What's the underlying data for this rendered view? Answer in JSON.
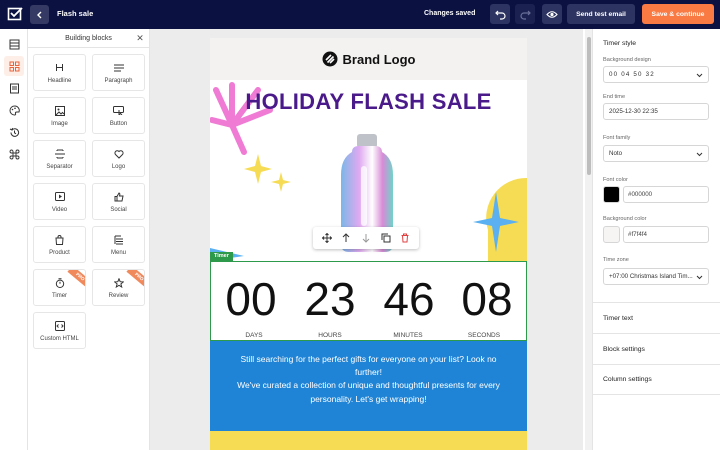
{
  "app": {
    "title": "Flash sale",
    "status": "Changes saved",
    "test_button": "Send test email",
    "save_button": "Save & continue"
  },
  "blocks_panel": {
    "title": "Building blocks",
    "items": [
      {
        "label": "Headline",
        "icon": "heading-icon",
        "pro": false
      },
      {
        "label": "Paragraph",
        "icon": "paragraph-icon",
        "pro": false
      },
      {
        "label": "Image",
        "icon": "image-icon",
        "pro": false
      },
      {
        "label": "Button",
        "icon": "button-icon",
        "pro": false
      },
      {
        "label": "Separator",
        "icon": "separator-icon",
        "pro": false
      },
      {
        "label": "Logo",
        "icon": "logo-icon",
        "pro": false
      },
      {
        "label": "Video",
        "icon": "video-icon",
        "pro": false
      },
      {
        "label": "Social",
        "icon": "thumbs-up-icon",
        "pro": false
      },
      {
        "label": "Product",
        "icon": "shopping-bag-icon",
        "pro": false
      },
      {
        "label": "Menu",
        "icon": "menu-icon",
        "pro": false
      },
      {
        "label": "Timer",
        "icon": "stopwatch-icon",
        "pro": true,
        "badge": "PRO"
      },
      {
        "label": "Review",
        "icon": "star-icon",
        "pro": true,
        "badge": "PRO"
      },
      {
        "label": "Custom HTML",
        "icon": "code-icon",
        "pro": false
      }
    ]
  },
  "email": {
    "brand": "Brand Logo",
    "headline": "HOLIDAY FLASH SALE",
    "timer_tag": "Timer",
    "timer": {
      "values": [
        "00",
        "23",
        "46",
        "08"
      ],
      "labels": [
        "DAYS",
        "HOURS",
        "MINUTES",
        "SECONDS"
      ]
    },
    "promo_line1": "Still searching for the perfect gifts for everyone on your list? Look no further!",
    "promo_line2": "We've curated a collection of unique and thoughtful presents for every personality. Let's get wrapping!"
  },
  "settings": {
    "timer_style_title": "Timer style",
    "background_design_label": "Background design",
    "background_design_value": "00 04 50 32",
    "end_time_label": "End time",
    "end_time_value": "2025-12-30 22:35",
    "font_family_label": "Font family",
    "font_family_value": "Noto",
    "font_color_label": "Font color",
    "font_color_value": "#000000",
    "background_color_label": "Background color",
    "background_color_value": "#f7f4f4",
    "time_zone_label": "Time zone",
    "time_zone_value": "+07:00 Christmas Island Tim...",
    "sections": [
      "Timer text",
      "Block settings",
      "Column settings"
    ]
  },
  "colors": {
    "topbar": "#0b1140",
    "accent": "#f97a42",
    "headline": "#4a1a8a",
    "promo": "#1f84d6",
    "timer_outline": "#2c9a4a"
  }
}
